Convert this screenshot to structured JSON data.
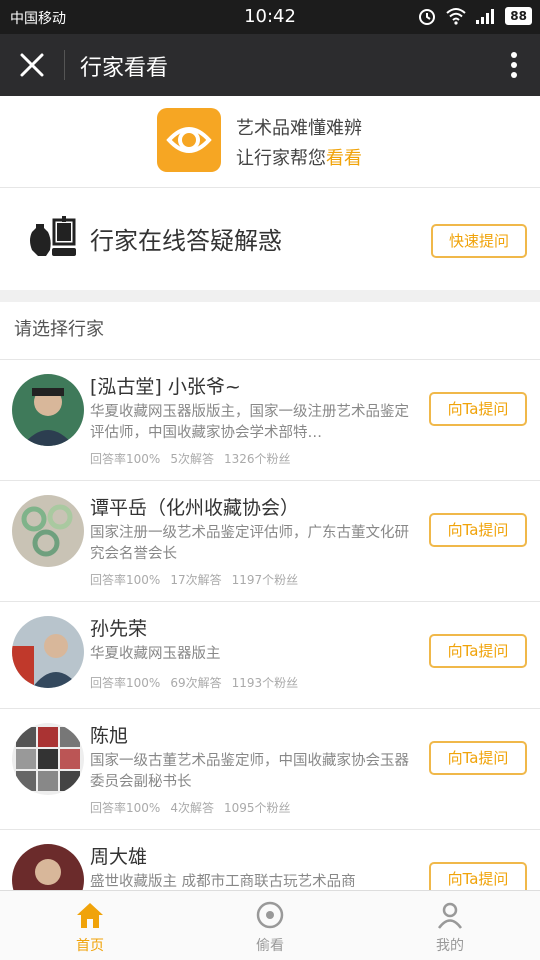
{
  "status": {
    "carrier": "中国移动",
    "time": "10:42",
    "battery": "88"
  },
  "nav": {
    "title": "行家看看"
  },
  "hero": {
    "line1": "艺术品难懂难辨",
    "line2_prefix": "让行家帮您",
    "line2_highlight": "看看"
  },
  "online": {
    "label": "行家在线答疑解惑",
    "button": "快速提问"
  },
  "list": {
    "header": "请选择行家",
    "experts": [
      {
        "name": "[泓古堂] 小张爷~",
        "desc": "华夏收藏网玉器版版主，国家一级注册艺术品鉴定评估师，中国收藏家协会学术部特…",
        "rate": "回答率100%",
        "answers": "5次解答",
        "fans": "1326个粉丝",
        "button": "向Ta提问"
      },
      {
        "name": "谭平岳（化州收藏协会）",
        "desc": "国家注册一级艺术品鉴定评估师，广东古董文化研究会名誉会长",
        "rate": "回答率100%",
        "answers": "17次解答",
        "fans": "1197个粉丝",
        "button": "向Ta提问"
      },
      {
        "name": "孙先荣",
        "desc": "华夏收藏网玉器版主",
        "rate": "回答率100%",
        "answers": "69次解答",
        "fans": "1193个粉丝",
        "button": "向Ta提问"
      },
      {
        "name": "陈旭",
        "desc": "国家一级古董艺术品鉴定师，中国收藏家协会玉器委员会副秘书长",
        "rate": "回答率100%",
        "answers": "4次解答",
        "fans": "1095个粉丝",
        "button": "向Ta提问"
      },
      {
        "name": "周大雄",
        "desc": "盛世收藏版主 成都市工商联古玩艺术品商",
        "rate": "",
        "answers": "",
        "fans": "",
        "button": "向Ta提问"
      }
    ]
  },
  "tabs": [
    {
      "label": "首页",
      "icon": "home-icon",
      "active": true
    },
    {
      "label": "偷看",
      "icon": "peek-icon",
      "active": false
    },
    {
      "label": "我的",
      "icon": "profile-icon",
      "active": false
    }
  ],
  "colors": {
    "accent": "#f0a30a",
    "navbar": "#2c2c2e",
    "statusbar": "#1c1c1c"
  }
}
